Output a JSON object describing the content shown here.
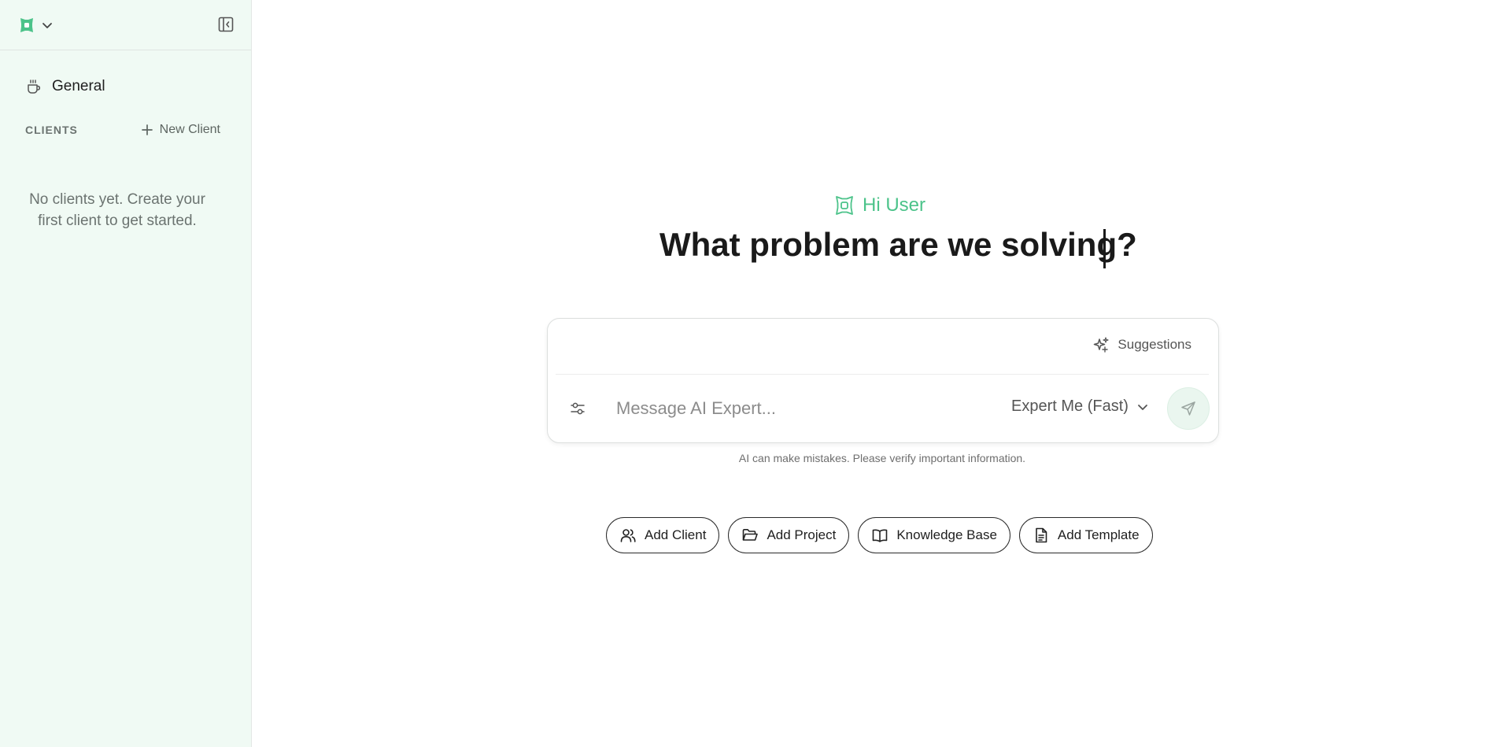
{
  "sidebar": {
    "general_label": "General",
    "clients_label": "CLIENTS",
    "new_client_label": "New Client",
    "empty_text": "No clients yet. Create your first client to get started."
  },
  "main": {
    "greeting": "Hi User",
    "headline": "What problem are we solving?",
    "suggestions_label": "Suggestions",
    "input_placeholder": "Message AI Expert...",
    "model_label": "Expert Me (Fast)",
    "disclaimer": "AI can make mistakes. Please verify important information.",
    "actions": [
      {
        "label": "Add Client",
        "icon": "users-icon"
      },
      {
        "label": "Add Project",
        "icon": "folder-open-icon"
      },
      {
        "label": "Knowledge Base",
        "icon": "book-icon"
      },
      {
        "label": "Add Template",
        "icon": "file-text-icon"
      }
    ]
  },
  "colors": {
    "accent": "#4cc38a",
    "sidebar_bg": "#f0faf4"
  }
}
